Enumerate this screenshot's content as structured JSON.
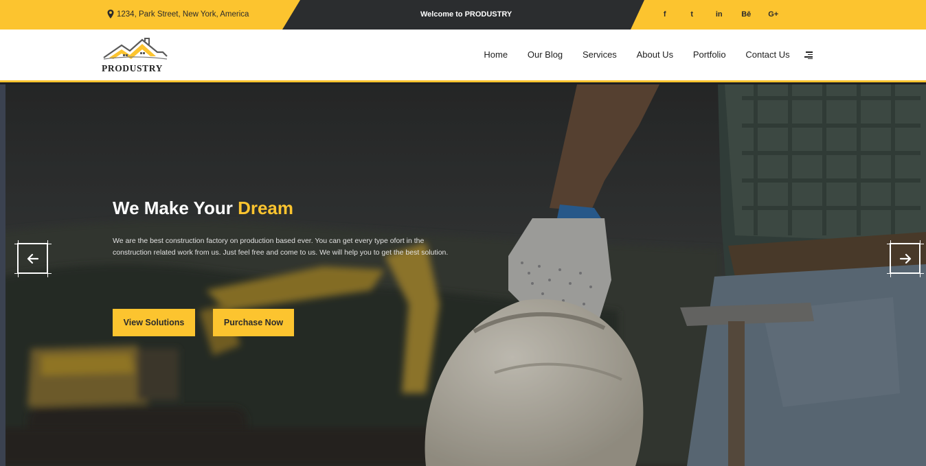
{
  "topbar": {
    "address": "1234, Park Street, New York, America",
    "welcome": "Welcome to PRODUSTRY",
    "socials": [
      {
        "label": "f",
        "icon": "facebook-icon"
      },
      {
        "label": "t",
        "icon": "twitter-icon"
      },
      {
        "label": "in",
        "icon": "linkedin-icon"
      },
      {
        "label": "Bē",
        "icon": "behance-icon"
      },
      {
        "label": "G+",
        "icon": "google-plus-icon"
      }
    ]
  },
  "header": {
    "logo_text": "PRODUSTRY",
    "nav": [
      "Home",
      "Our Blog",
      "Services",
      "About Us",
      "Portfolio",
      "Contact Us"
    ]
  },
  "hero": {
    "title_main": "We Make Your ",
    "title_accent": "Dream",
    "text": "We are the best construction factory on production based ever. You can get every type ofort in the construction related work from us. Just feel free and come to us. We will help you to get the best solution.",
    "button_primary": "View Solutions",
    "button_secondary": "Purchase Now"
  },
  "colors": {
    "accent": "#fcc42f",
    "dark": "#2b2d2f",
    "white": "#ffffff"
  }
}
